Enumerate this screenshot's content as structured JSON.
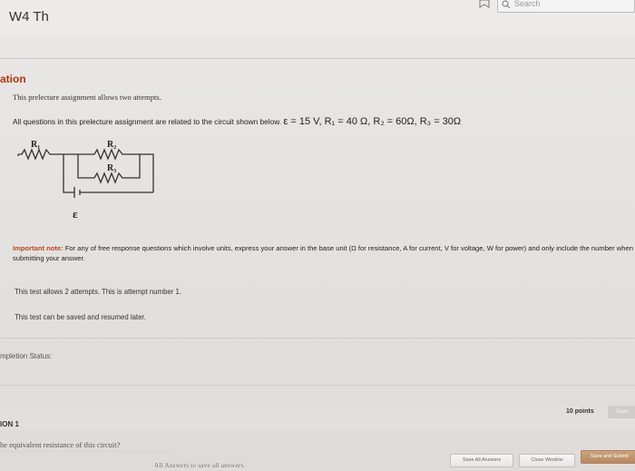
{
  "header": {
    "course_title": "W4 Th",
    "search_placeholder": "Search"
  },
  "section": {
    "title": "ation",
    "attempts_note": "This prelecture assignment allows two attempts.",
    "circuit_intro": "All questions in this prelecture assignment are related to the circuit shown below.",
    "circuit_equation": "ε = 15 V, R₁ = 40 Ω, R₂ = 60Ω, R₃ = 30Ω",
    "circuit_labels": {
      "r1": "R₁",
      "r2": "R₂",
      "r3": "R₃",
      "emf": "ε"
    },
    "important_label": "Important note:",
    "important_text": " For any of free response questions which involve units, express your answer in the base unit (Ω for resistance, A for current, V for voltage, W for power) and only include the number when submitting your answer.",
    "attempt_count": "This test allows 2 attempts. This is attempt number 1.",
    "resume_note": "This test can be saved and resumed later.",
    "completion_label": "mpletion Status:"
  },
  "question": {
    "label": "ION 1",
    "points": "10 points",
    "save_label": "Save",
    "text": "he equivalent resistance of this circuit?"
  },
  "footer": {
    "hint": "All Answers to save all answers.",
    "save_all": "Save All Answers",
    "close_window": "Close Window",
    "save_submit": "Save and Submit"
  },
  "colors": {
    "accent": "#b8360f",
    "submit": "#b9895e"
  }
}
